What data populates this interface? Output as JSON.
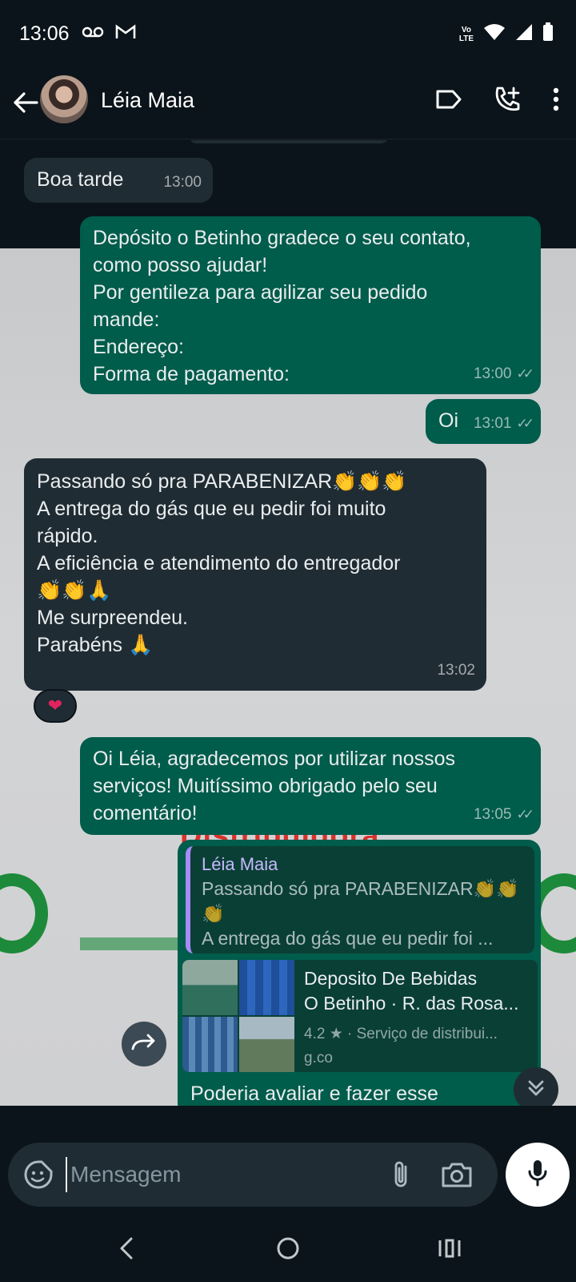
{
  "status_bar": {
    "time": "13:06",
    "volte_line1": "Vo",
    "volte_line2": "LTE"
  },
  "header": {
    "contact_name": "Léia Maia"
  },
  "messages": [
    {
      "direction": "in",
      "text": "Boa tarde",
      "time": "13:00"
    },
    {
      "direction": "out",
      "lines": [
        "Depósito o Betinho gradece o seu contato,",
        "como posso ajudar!",
        "Por gentileza para agilizar seu pedido",
        "mande:",
        "Endereço:",
        "Forma de pagamento:"
      ],
      "time": "13:00"
    },
    {
      "direction": "out",
      "text": "Oi",
      "time": "13:01"
    },
    {
      "direction": "in",
      "lines": [
        "Passando só pra PARABENIZAR👏👏👏",
        "A entrega do gás que eu pedir foi muito",
        "rápido.",
        "A eficiência e atendimento do entregador",
        "👏👏🙏",
        "Me surpreendeu.",
        "Parabéns 🙏"
      ],
      "time": "13:02",
      "reaction": "❤"
    },
    {
      "direction": "out",
      "lines": [
        "Oi Léia, agradecemos por utilizar nossos",
        "serviços! Muitíssimo obrigado pelo seu",
        "comentário!"
      ],
      "time": "13:05"
    },
    {
      "direction": "out",
      "quote": {
        "author": "Léia Maia",
        "line1": "Passando só pra PARABENIZAR👏👏",
        "line2": "👏",
        "line3": "A entrega do gás que eu pedir foi ..."
      },
      "link_preview": {
        "title_line1": "Deposito De Bebidas",
        "title_line2": "O Betinho · R. das Rosa...",
        "subtitle": "4.2 ★ · Serviço de distribui...",
        "domain": "g.co"
      },
      "partial_text": "Poderia avaliar e fazer esse"
    }
  ],
  "wallpaper": {
    "brand_text": "Distribuidora"
  },
  "composer": {
    "placeholder": "Mensagem"
  },
  "colors": {
    "incoming_bubble": "#202c33",
    "outgoing_bubble": "#005c4b",
    "background": "#0b141a",
    "reaction_heart": "#e0245e"
  }
}
